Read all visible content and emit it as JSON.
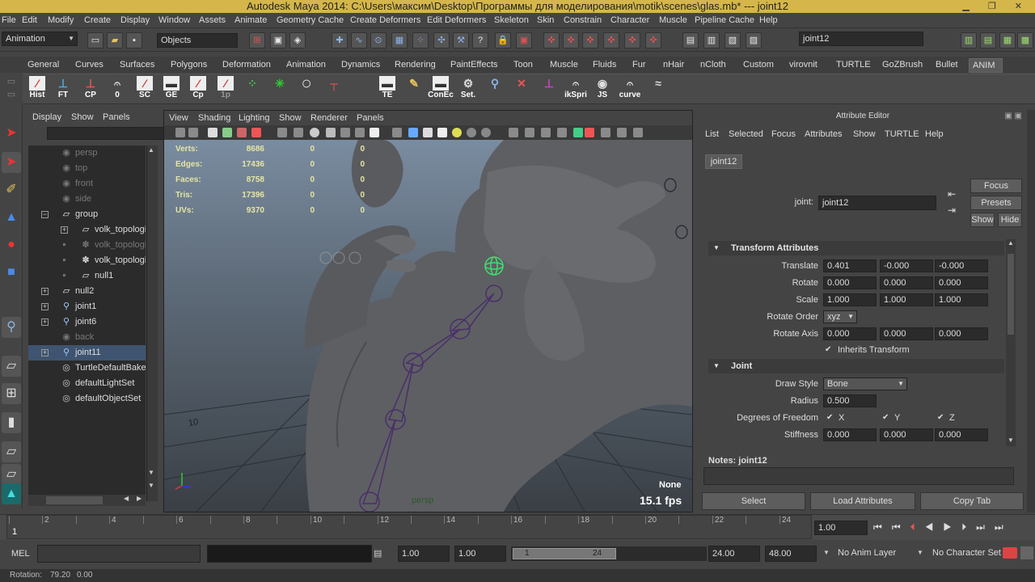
{
  "title": "Autodesk Maya 2014: C:\\Users\\максим\\Desktop\\Программы для моделирования\\motik\\scenes\\glas.mb*   ---   joint12",
  "menubar": [
    "File",
    "Edit",
    "Modify",
    "Create",
    "Display",
    "Window",
    "Assets",
    "Animate",
    "Geometry Cache",
    "Create Deformers",
    "Edit Deformers",
    "Skeleton",
    "Skin",
    "Constrain",
    "Character",
    "Muscle",
    "Pipeline Cache",
    "Help"
  ],
  "status_line": {
    "mode": "Animation",
    "select_mode": "Objects",
    "search_value": "joint12"
  },
  "shelf_tabs": [
    "General",
    "Curves",
    "Surfaces",
    "Polygons",
    "Deformation",
    "Animation",
    "Dynamics",
    "Rendering",
    "PaintEffects",
    "Toon",
    "Muscle",
    "Fluids",
    "Fur",
    "nHair",
    "nCloth",
    "Custom",
    "virovnit",
    "TURTLE",
    "GoZBrush",
    "Bullet",
    "ANIM"
  ],
  "shelf_active_tab": "ANIM",
  "shelf_buttons": [
    "Hist",
    "FT",
    "CP",
    "0",
    "SC",
    "GE",
    "Cp",
    "1p",
    "",
    "",
    "",
    "",
    "TE",
    "",
    "ConEc",
    "Set.",
    "",
    "",
    "",
    "ikSpri",
    "JS",
    "curve"
  ],
  "outliner": {
    "menu": [
      "Display",
      "Show",
      "Panels"
    ],
    "items": [
      {
        "label": "persp",
        "indent": 0,
        "dim": true,
        "expander": ""
      },
      {
        "label": "top",
        "indent": 0,
        "dim": true,
        "expander": ""
      },
      {
        "label": "front",
        "indent": 0,
        "dim": true,
        "expander": ""
      },
      {
        "label": "side",
        "indent": 0,
        "dim": true,
        "expander": ""
      },
      {
        "label": "group",
        "indent": 0,
        "dim": false,
        "expander": "−"
      },
      {
        "label": "volk_topologi:c",
        "indent": 1,
        "dim": false,
        "expander": "+"
      },
      {
        "label": "volk_topologi:E",
        "indent": 1,
        "dim": true,
        "expander": ""
      },
      {
        "label": "volk_topologi:p",
        "indent": 1,
        "dim": false,
        "expander": ""
      },
      {
        "label": "null1",
        "indent": 1,
        "dim": false,
        "expander": ""
      },
      {
        "label": "null2",
        "indent": 0,
        "dim": false,
        "expander": "+"
      },
      {
        "label": "joint1",
        "indent": 0,
        "dim": false,
        "expander": "+"
      },
      {
        "label": "joint6",
        "indent": 0,
        "dim": false,
        "expander": "+"
      },
      {
        "label": "back",
        "indent": 0,
        "dim": true,
        "expander": ""
      },
      {
        "label": "joint11",
        "indent": 0,
        "dim": false,
        "expander": "+",
        "selected": true
      },
      {
        "label": "TurtleDefaultBakeL",
        "indent": 0,
        "dim": false,
        "expander": ""
      },
      {
        "label": "defaultLightSet",
        "indent": 0,
        "dim": false,
        "expander": ""
      },
      {
        "label": "defaultObjectSet",
        "indent": 0,
        "dim": false,
        "expander": ""
      }
    ]
  },
  "viewport": {
    "menu": [
      "View",
      "Shading",
      "Lighting",
      "Show",
      "Renderer",
      "Panels"
    ],
    "hud": [
      {
        "label": "Verts:",
        "v1": "8686",
        "v2": "0",
        "v3": "0"
      },
      {
        "label": "Edges:",
        "v1": "17436",
        "v2": "0",
        "v3": "0"
      },
      {
        "label": "Faces:",
        "v1": "8758",
        "v2": "0",
        "v3": "0"
      },
      {
        "label": "Tris:",
        "v1": "17396",
        "v2": "0",
        "v3": "0"
      },
      {
        "label": "UVs:",
        "v1": "9370",
        "v2": "0",
        "v3": "0"
      }
    ],
    "camera": "persp",
    "none_label": "None",
    "fps": "15.1 fps",
    "grid_label": "10"
  },
  "attribute_editor": {
    "header": "Attribute Editor",
    "menu": [
      "List",
      "Selected",
      "Focus",
      "Attributes",
      "Show",
      "TURTLE",
      "Help"
    ],
    "tab": "joint12",
    "node_label": "joint:",
    "node_name": "joint12",
    "focus_btn": "Focus",
    "presets_btn": "Presets",
    "show_btn": "Show",
    "hide_btn": "Hide",
    "transform_section": "Transform Attributes",
    "translate_label": "Translate",
    "translate": [
      "0.401",
      "-0.000",
      "-0.000"
    ],
    "rotate_label": "Rotate",
    "rotate": [
      "0.000",
      "0.000",
      "0.000"
    ],
    "scale_label": "Scale",
    "scale": [
      "1.000",
      "1.000",
      "1.000"
    ],
    "rotate_order_label": "Rotate Order",
    "rotate_order": "xyz",
    "rotate_axis_label": "Rotate Axis",
    "rotate_axis": [
      "0.000",
      "0.000",
      "0.000"
    ],
    "inherits_transform": "Inherits Transform",
    "joint_section": "Joint",
    "draw_style_label": "Draw Style",
    "draw_style": "Bone",
    "radius_label": "Radius",
    "radius": "0.500",
    "dof_label": "Degrees of Freedom",
    "dof": [
      "X",
      "Y",
      "Z"
    ],
    "stiffness_label": "Stiffness",
    "stiffness": [
      "0.000",
      "0.000",
      "0.000"
    ],
    "notes_label": "Notes:  joint12",
    "select_btn": "Select",
    "load_btn": "Load Attributes",
    "copy_btn": "Copy Tab"
  },
  "timeline": {
    "ticks": [
      "2",
      "4",
      "6",
      "8",
      "10",
      "12",
      "14",
      "16",
      "18",
      "20",
      "22",
      "24"
    ],
    "current_frame": "1",
    "current_time_field": "1.00"
  },
  "range": {
    "start": "1.00",
    "start2": "1.00",
    "range_start": "1",
    "range_end": "24",
    "end": "24.00",
    "end2": "48.00",
    "anim_layer": "No Anim Layer",
    "character_set": "No Character Set"
  },
  "command_line": {
    "label": "MEL"
  },
  "help_line": {
    "label": "Rotation:",
    "value1": "79.20",
    "value2": "0.00"
  },
  "colors": {
    "title_bg": "#d4b64a",
    "selection": "#3e5470",
    "hud_text": "#e6e6a0",
    "joint": "#4a2f6b"
  }
}
